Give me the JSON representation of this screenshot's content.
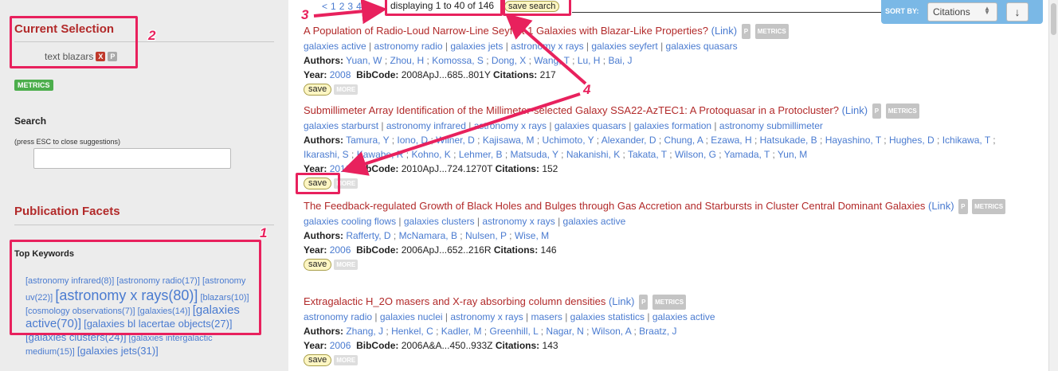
{
  "sidebar": {
    "current_selection_title": "Current Selection",
    "selection_item": "text blazars",
    "remove_badge": "X",
    "p_badge": "P",
    "metrics": "METRICS",
    "search_label": "Search",
    "search_hint": "(press ESC to close suggestions)",
    "search_value": "",
    "facets_title": "Publication Facets",
    "keywords_title": "Top Keywords",
    "keywords": [
      {
        "label": "[astronomy infrared(8)]",
        "size": "s1"
      },
      {
        "label": "[astronomy radio(17)]",
        "size": "s1"
      },
      {
        "label": "[astronomy uv(22)]",
        "size": "s1"
      },
      {
        "label": "[astronomy x rays(80)]",
        "size": "s3"
      },
      {
        "label": "[blazars(10)]",
        "size": "s1"
      },
      {
        "label": "[cosmology observations(7)]",
        "size": "s1"
      },
      {
        "label": "[galaxies(14)]",
        "size": "s1"
      },
      {
        "label": "[galaxies active(70)]",
        "size": "s4"
      },
      {
        "label": "[galaxies bl lacertae objects(27)]",
        "size": "s2"
      },
      {
        "label": "[galaxies clusters(24)]",
        "size": "s2"
      },
      {
        "label": "[galaxies intergalactic medium(15)]",
        "size": "s1"
      },
      {
        "label": "[galaxies jets(31)]",
        "size": "s2"
      }
    ]
  },
  "annotations": [
    "1",
    "2",
    "3",
    "4"
  ],
  "results_header": {
    "prev": "<",
    "pages": [
      "1",
      "2",
      "3",
      "4"
    ],
    "next": ">",
    "display_text": "displaying 1 to 40 of 146",
    "save_search": "save search"
  },
  "sort": {
    "label": "SORT BY:",
    "value": "Citations",
    "direction": "↓"
  },
  "records": [
    {
      "title": "A Population of Radio-Loud Narrow-Line Seyfert 1 Galaxies with Blazar-Like Properties?",
      "link": "(Link)",
      "keywords": [
        "galaxies active",
        "astronomy radio",
        "galaxies jets",
        "astronomy x rays",
        "galaxies seyfert",
        "galaxies quasars"
      ],
      "authors": [
        "Yuan, W",
        "Zhou, H",
        "Komossa, S",
        "Dong, X",
        "Wang, T",
        "Lu, H",
        "Bai, J"
      ],
      "year": "2008",
      "bibcode": "2008ApJ...685..801Y",
      "citations": "217"
    },
    {
      "title": "Submillimeter Array Identification of the Millimeter-selected Galaxy SSA22-AzTEC1: A Protoquasar in a Protocluster?",
      "link": "(Link)",
      "keywords": [
        "galaxies starburst",
        "astronomy infrared",
        "astronomy x rays",
        "galaxies quasars",
        "galaxies formation",
        "astronomy submillimeter"
      ],
      "authors": [
        "Tamura, Y",
        "Iono, D",
        "Wilner, D",
        "Kajisawa, M",
        "Uchimoto, Y",
        "Alexander, D",
        "Chung, A",
        "Ezawa, H",
        "Hatsukade, B",
        "Hayashino, T",
        "Hughes, D",
        "Ichikawa, T",
        "Ikarashi, S",
        "Kawabe, R",
        "Kohno, K",
        "Lehmer, B",
        "Matsuda, Y",
        "Nakanishi, K",
        "Takata, T",
        "Wilson, G",
        "Yamada, T",
        "Yun, M"
      ],
      "year": "2010",
      "bibcode": "2010ApJ...724.1270T",
      "citations": "152"
    },
    {
      "title": "The Feedback-regulated Growth of Black Holes and Bulges through Gas Accretion and Starbursts in Cluster Central Dominant Galaxies",
      "link": "(Link)",
      "keywords": [
        "galaxies cooling flows",
        "galaxies clusters",
        "astronomy x rays",
        "galaxies active"
      ],
      "authors": [
        "Rafferty, D",
        "McNamara, B",
        "Nulsen, P",
        "Wise, M"
      ],
      "year": "2006",
      "bibcode": "2006ApJ...652..216R",
      "citations": "146"
    },
    {
      "title": "Extragalactic H_2O masers and X-ray absorbing column densities",
      "link": "(Link)",
      "keywords": [
        "astronomy radio",
        "galaxies nuclei",
        "astronomy x rays",
        "masers",
        "galaxies statistics",
        "galaxies active"
      ],
      "authors": [
        "Zhang, J",
        "Henkel, C",
        "Kadler, M",
        "Greenhill, L",
        "Nagar, N",
        "Wilson, A",
        "Braatz, J"
      ],
      "year": "2006",
      "bibcode": "2006A&A...450..933Z",
      "citations": "143"
    }
  ],
  "labels": {
    "authors": "Authors:",
    "year": "Year:",
    "bibcode": "BibCode:",
    "citations": "Citations:",
    "save": "save",
    "more": "MORE",
    "p": "P",
    "metrics": "METRICS"
  },
  "colors": {
    "title_red": "#b22a2a",
    "link_blue": "#4a7bd0",
    "annotation_pink": "#e8215d",
    "sort_bar": "#7ab8e6",
    "metrics_green": "#4cae4c"
  }
}
